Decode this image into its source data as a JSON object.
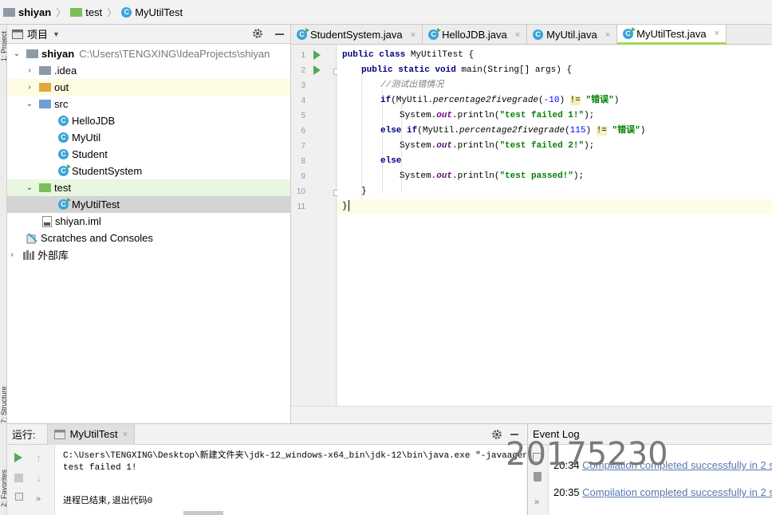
{
  "breadcrumb": {
    "project": "shiyan",
    "folder": "test",
    "file": "MyUtilTest"
  },
  "left_stripe": {
    "project_label": "1: Project",
    "structure_label": "7: Structure",
    "favorites_label": "2: Favorites"
  },
  "project_panel": {
    "title": "项目",
    "tree": {
      "root_name": "shiyan",
      "root_path": "C:\\Users\\TENGXING\\IdeaProjects\\shiyan",
      "idea": ".idea",
      "out": "out",
      "src": "src",
      "src_classes": [
        "HelloJDB",
        "MyUtil",
        "Student",
        "StudentSystem"
      ],
      "test": "test",
      "test_class": "MyUtilTest",
      "iml": "shiyan.iml",
      "scratches": "Scratches and Consoles",
      "libraries": "外部库"
    }
  },
  "editor": {
    "tabs": [
      {
        "label": "StudentSystem.java",
        "close": "×"
      },
      {
        "label": "HelloJDB.java",
        "close": "×"
      },
      {
        "label": "MyUtil.java",
        "close": "×"
      },
      {
        "label": "MyUtilTest.java",
        "close": "×"
      }
    ],
    "line_numbers": [
      "1",
      "2",
      "3",
      "4",
      "5",
      "6",
      "7",
      "8",
      "9",
      "10",
      "11"
    ],
    "code": {
      "l1_kw": "public class ",
      "l1_rest": "MyUtilTest {",
      "l2_kw": "public static void ",
      "l2_rest": "main(String[] args) {",
      "l3_comment": "//测试出错情况",
      "l4_kw": "if",
      "l4_a": "(MyUtil.",
      "l4_method": "percentage2fivegrade",
      "l4_b": "(",
      "l4_num": "-10",
      "l4_c": ") ",
      "l4_op": "!=",
      "l4_d": " ",
      "l4_str": "\"错误\"",
      "l4_e": ")",
      "l5_a": "System.",
      "l5_out": "out",
      "l5_b": ".println(",
      "l5_str": "\"test failed 1!\"",
      "l5_c": ");",
      "l6_kw": "else if",
      "l6_a": "(MyUtil.",
      "l6_method": "percentage2fivegrade",
      "l6_b": "(",
      "l6_num": "115",
      "l6_c": ") ",
      "l6_op": "!=",
      "l6_d": " ",
      "l6_str": "\"错误\"",
      "l6_e": ")",
      "l7_a": "System.",
      "l7_out": "out",
      "l7_b": ".println(",
      "l7_str": "\"test failed 2!\"",
      "l7_c": ");",
      "l8_kw": "else",
      "l9_a": "System.",
      "l9_out": "out",
      "l9_b": ".println(",
      "l9_str": "\"test passed!\"",
      "l9_c": ");",
      "l10": "}",
      "l11": "}"
    }
  },
  "run_panel": {
    "label": "运行:",
    "tab": "MyUtilTest",
    "console": [
      "C:\\Users\\TENGXING\\Desktop\\新建文件夹\\jdk-12_windows-x64_bin\\jdk-12\\bin\\java.exe \"-javaagent:C:\\P",
      "test failed 1!",
      "",
      "进程已结束,退出代码0"
    ]
  },
  "event_log": {
    "title": "Event Log",
    "entries": [
      {
        "time": "20:34",
        "message": "Compilation completed successfully in 2 s"
      },
      {
        "time": "20:35",
        "message": "Compilation completed successfully in 2 s"
      }
    ]
  },
  "watermark": "20175230",
  "colors": {
    "folder_gray": "#8c9aa7",
    "folder_blue": "#6f9fd6",
    "folder_orange": "#e0a742",
    "folder_green": "#7dbd5a",
    "class_blue": "#3aa4d8",
    "run_green": "#4fab5a",
    "keyword": "#000080",
    "string": "#008000",
    "active_tab_underline": "#a3d95c"
  }
}
